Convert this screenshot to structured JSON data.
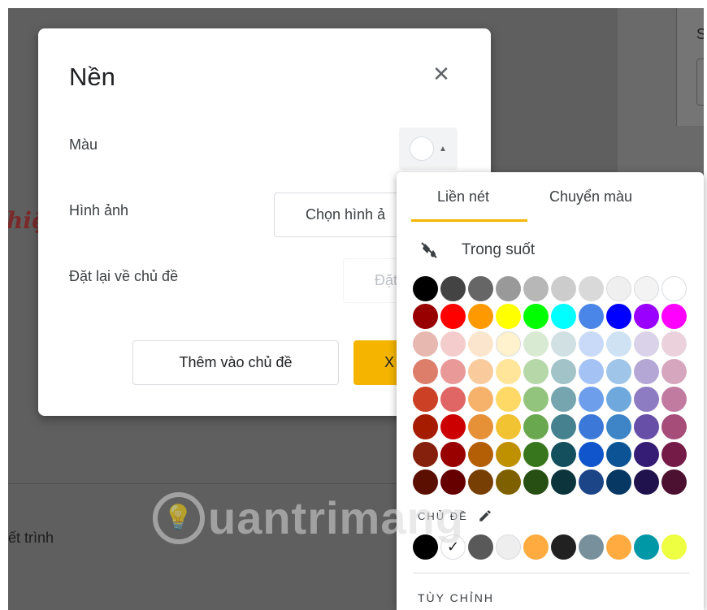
{
  "background": {
    "side_text": "S",
    "red_fragment": "hiệ",
    "lower_left_text": "ết trình",
    "watermark": "uantrimang"
  },
  "dialog": {
    "title": "Nền",
    "color_label": "Màu",
    "image_label": "Hình ảnh",
    "image_button": "Chọn hình ả",
    "reset_label": "Đặt lại về chủ đề",
    "reset_button": "Đặt",
    "add_theme_button": "Thêm vào chủ đề",
    "done_button": "X"
  },
  "picker": {
    "tabs": [
      "Liền nét",
      "Chuyển màu"
    ],
    "active_tab": 0,
    "transparent_label": "Trong suốt",
    "theme_heading": "CHỦ ĐỀ",
    "custom_label": "TÙY CHỈNH",
    "rows": [
      [
        "#000000",
        "#434343",
        "#666666",
        "#999999",
        "#b7b7b7",
        "#cccccc",
        "#d9d9d9",
        "#efefef",
        "#f3f3f3",
        "#ffffff"
      ],
      [
        "#980000",
        "#ff0000",
        "#ff9900",
        "#ffff00",
        "#00ff00",
        "#00ffff",
        "#4a86e8",
        "#0000ff",
        "#9900ff",
        "#ff00ff"
      ],
      [
        "#e6b8af",
        "#f4cccc",
        "#fce5cd",
        "#fff2cc",
        "#d9ead3",
        "#d0e0e3",
        "#c9daf8",
        "#cfe2f3",
        "#d9d2e9",
        "#ead1dc"
      ],
      [
        "#dd7e6b",
        "#ea9999",
        "#f9cb9c",
        "#ffe599",
        "#b6d7a8",
        "#a2c4c9",
        "#a4c2f4",
        "#9fc5e8",
        "#b4a7d6",
        "#d5a6bd"
      ],
      [
        "#cc4125",
        "#e06666",
        "#f6b26b",
        "#ffd966",
        "#93c47d",
        "#76a5af",
        "#6d9eeb",
        "#6fa8dc",
        "#8e7cc3",
        "#c27ba0"
      ],
      [
        "#a61c00",
        "#cc0000",
        "#e69138",
        "#f1c232",
        "#6aa84f",
        "#45818e",
        "#3c78d8",
        "#3d85c6",
        "#674ea7",
        "#a64d79"
      ],
      [
        "#85200c",
        "#990000",
        "#b45f06",
        "#bf9000",
        "#38761d",
        "#134f5c",
        "#1155cc",
        "#0b5394",
        "#351c75",
        "#741b47"
      ],
      [
        "#5b0f00",
        "#660000",
        "#783f04",
        "#7f6000",
        "#274e13",
        "#0c343d",
        "#1c4587",
        "#073763",
        "#20124d",
        "#4c1130"
      ]
    ],
    "theme_colors": [
      "#000000",
      "#ffffff",
      "#595959",
      "#eeeeee",
      "#ffab40",
      "#212121",
      "#78909c",
      "#ffab40",
      "#0097a7",
      "#eeff41"
    ],
    "theme_selected": 1
  }
}
